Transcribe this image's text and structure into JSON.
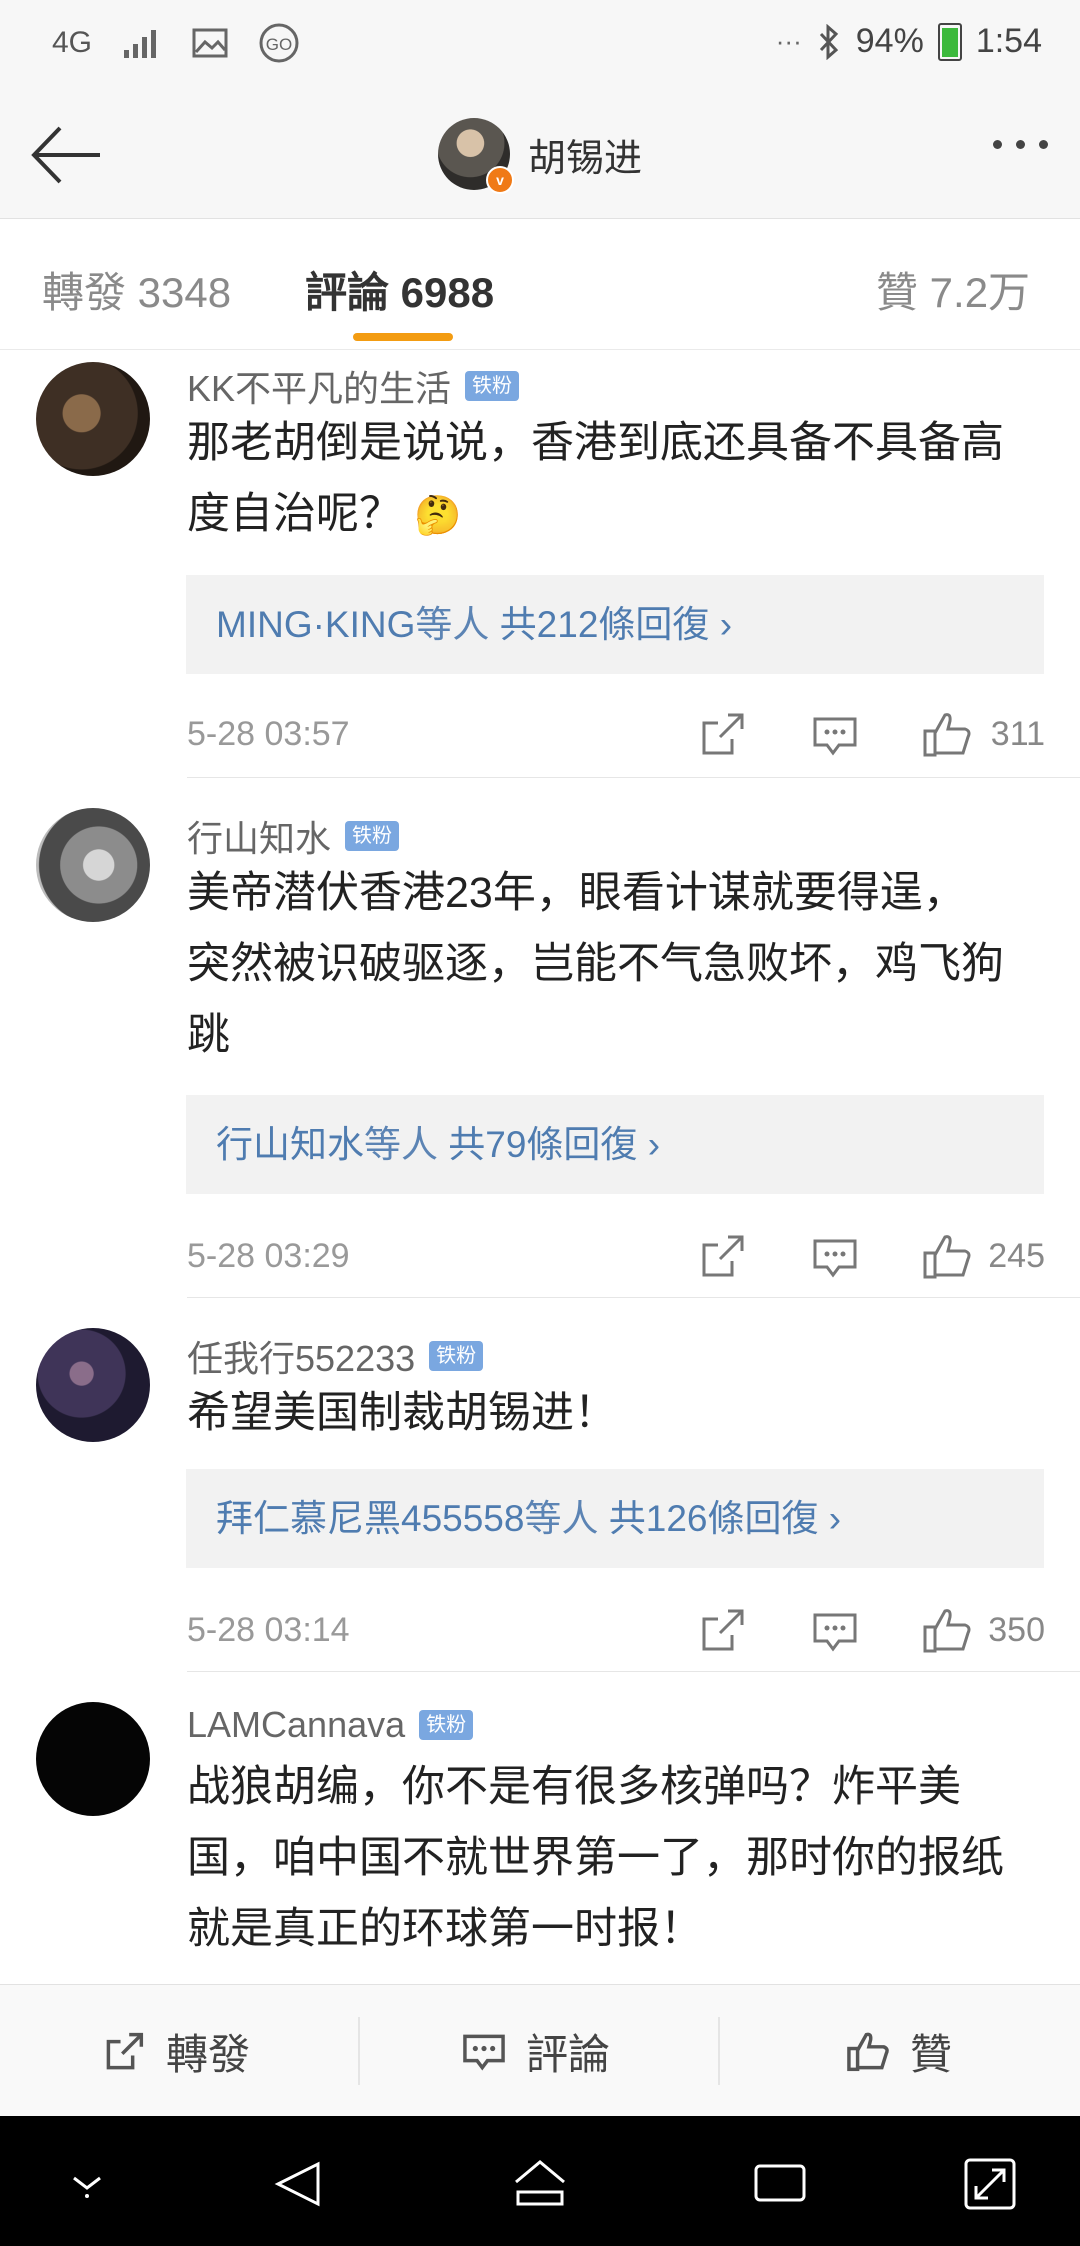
{
  "status_bar": {
    "network": "4G",
    "battery": "94%",
    "time": "1:54",
    "dots": "···"
  },
  "header": {
    "title": "胡锡进"
  },
  "tabs": [
    {
      "label": "轉發 3348"
    },
    {
      "label": "評論 6988"
    },
    {
      "label": "贊 7.2万"
    }
  ],
  "comments": [
    {
      "username": "KK不平凡的生活",
      "badge": "铁粉",
      "text_lines": [
        "那老胡倒是说说，香港到底还具备不具备高",
        "度自治呢？"
      ],
      "emoji": "🤔",
      "reply_user": "MING·KING",
      "reply_suffix": "等人",
      "reply_count": " 共212條回復",
      "time": "5-28 03:57",
      "likes": "311"
    },
    {
      "username": "行山知水",
      "badge": "铁粉",
      "text_lines": [
        "美帝潜伏香港23年，眼看计谋就要得逞，",
        "突然被识破驱逐，岂能不气急败坏，鸡飞狗",
        "跳"
      ],
      "reply_user": "行山知水",
      "reply_suffix": "等人",
      "reply_count": " 共79條回復",
      "time": "5-28 03:29",
      "likes": "245"
    },
    {
      "username": "任我行552233",
      "badge": "铁粉",
      "text_lines": [
        "希望美国制裁胡锡进！"
      ],
      "reply_user": "拜仁慕尼黑455558",
      "reply_suffix": "等人",
      "reply_count": " 共126條回復",
      "time": "5-28 03:14",
      "likes": "350"
    },
    {
      "username": "LAMCannava",
      "badge": "铁粉",
      "text_lines": [
        "战狼胡编，你不是有很多核弹吗？炸平美",
        "国，咱中国不就世界第一了，那时你的报纸",
        "就是真正的环球第一时报！"
      ]
    }
  ],
  "bottom_bar": {
    "repost": "轉發",
    "comment": "評論",
    "like": "贊"
  },
  "colors": {
    "accent": "#f39c12",
    "link": "#4f7cb0",
    "badge": "#7aa7e0"
  }
}
